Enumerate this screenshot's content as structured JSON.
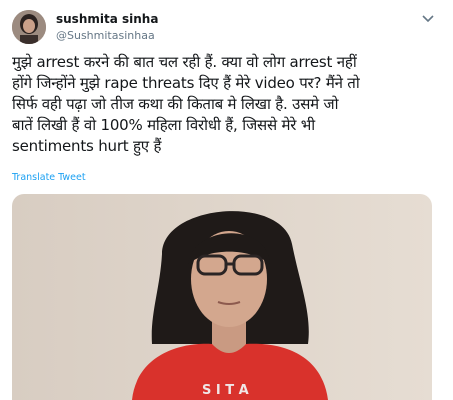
{
  "tweet": {
    "author_name": "sushmita sinha",
    "author_handle": "@Sushmitasinhaa",
    "text": "मुझे arrest करने की बात चल रही हैं. क्या वो लोग arrest नहीं\nहोंगे जिन्होंने मुझे rape threats दिए हैं मेरे video पर? मैंने तो\nसिर्फ वही पढ़ा जो तीज कथा की किताब मे लिखा है. उसमे जो\nबातें लिखी हैं वो 100% महिला विरोधी हैं, जिससे मेरे भी\nsentiments hurt हुए हैं",
    "translate_label": "Translate Tweet"
  },
  "icons": {
    "menu": "chevron-down-icon"
  },
  "colors": {
    "link": "#1da1f2",
    "text": "#14171a",
    "muted": "#657786",
    "shirt": "#d9322c"
  }
}
